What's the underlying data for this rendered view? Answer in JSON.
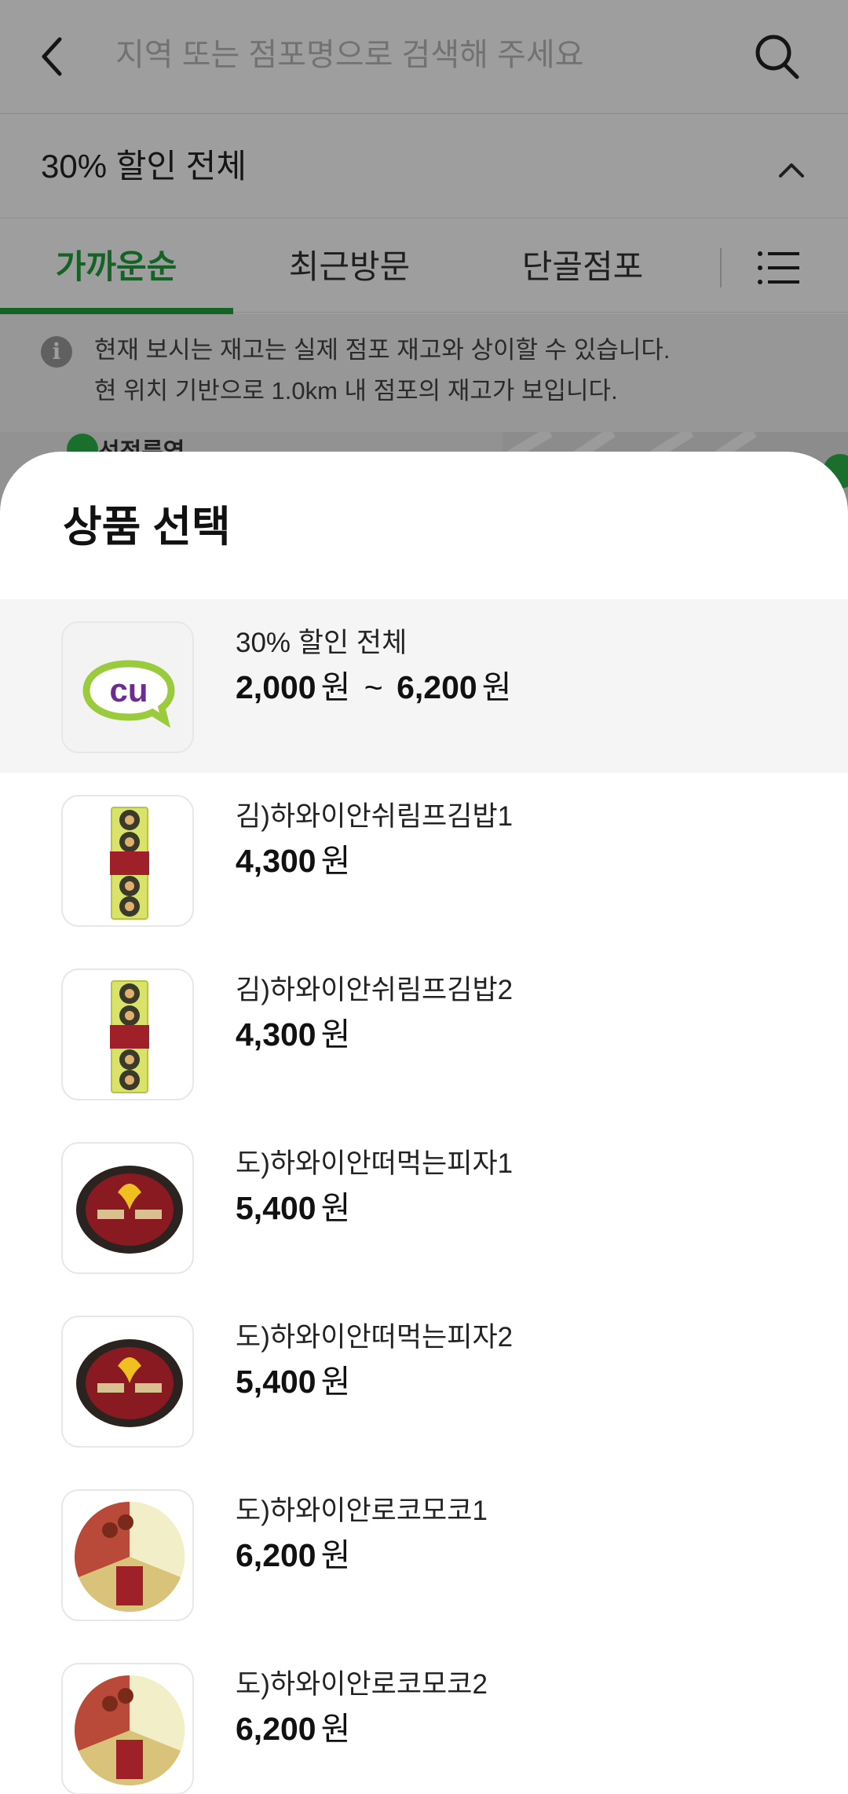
{
  "header": {
    "search_placeholder": "지역 또는 점포명으로 검색해 주세요"
  },
  "filter": {
    "label": "30% 할인 전체"
  },
  "tabs": [
    {
      "label": "가까운순",
      "active": true
    },
    {
      "label": "최근방문",
      "active": false
    },
    {
      "label": "단골점포",
      "active": false
    }
  ],
  "notice": {
    "line1": "현재 보시는 재고는 실제 점포 재고와 상이할 수 있습니다.",
    "line2": "현 위치 기반으로 1.0km 내 점포의 재고가 보입니다."
  },
  "map": {
    "label": "선정릉역"
  },
  "sheet": {
    "title": "상품 선택",
    "currency": "원",
    "range_sep": "~",
    "items": [
      {
        "name": "30% 할인 전체",
        "price_from": "2,000",
        "price_to": "6,200",
        "icon": "cu-logo-icon",
        "selected": true
      },
      {
        "name": "김)하와이안쉬림프김밥1",
        "price": "4,300",
        "icon": "gimbap-icon"
      },
      {
        "name": "김)하와이안쉬림프김밥2",
        "price": "4,300",
        "icon": "gimbap-icon"
      },
      {
        "name": "도)하와이안떠먹는피자1",
        "price": "5,400",
        "icon": "pizza-bowl-icon"
      },
      {
        "name": "도)하와이안떠먹는피자2",
        "price": "5,400",
        "icon": "pizza-bowl-icon"
      },
      {
        "name": "도)하와이안로코모코1",
        "price": "6,200",
        "icon": "lunchbox-icon"
      },
      {
        "name": "도)하와이안로코모코2",
        "price": "6,200",
        "icon": "lunchbox-icon"
      }
    ]
  },
  "colors": {
    "accent_green": "#1fa03c",
    "cu_purple": "#6b2d90",
    "cu_green": "#9acb3c"
  }
}
